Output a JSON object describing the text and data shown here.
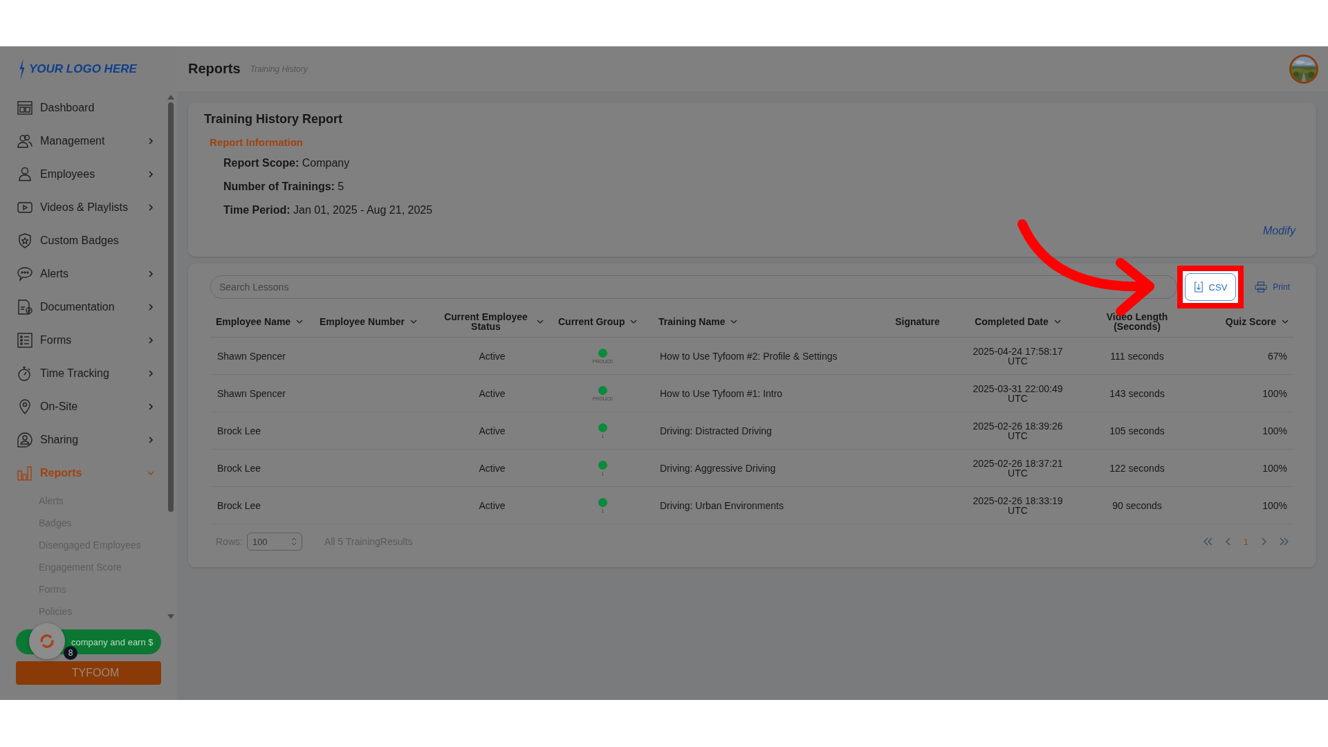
{
  "logo": {
    "text": "YOUR LOGO HERE"
  },
  "header": {
    "title": "Reports",
    "subtitle": "Training History"
  },
  "sidebar": {
    "items": [
      {
        "label": "Dashboard",
        "has_submenu": false,
        "selected": false
      },
      {
        "label": "Management",
        "has_submenu": true,
        "expanded": false,
        "selected": false
      },
      {
        "label": "Employees",
        "has_submenu": true,
        "expanded": false,
        "selected": false
      },
      {
        "label": "Videos & Playlists",
        "has_submenu": true,
        "expanded": false,
        "selected": false
      },
      {
        "label": "Custom Badges",
        "has_submenu": false,
        "selected": false
      },
      {
        "label": "Alerts",
        "has_submenu": true,
        "expanded": false,
        "selected": false
      },
      {
        "label": "Documentation",
        "has_submenu": true,
        "expanded": false,
        "selected": false
      },
      {
        "label": "Forms",
        "has_submenu": true,
        "expanded": false,
        "selected": false
      },
      {
        "label": "Time Tracking",
        "has_submenu": true,
        "expanded": false,
        "selected": false
      },
      {
        "label": "On-Site",
        "has_submenu": true,
        "expanded": false,
        "selected": false
      },
      {
        "label": "Sharing",
        "has_submenu": true,
        "expanded": false,
        "selected": false
      },
      {
        "label": "Reports",
        "has_submenu": true,
        "expanded": true,
        "selected": true,
        "children": [
          {
            "label": "Alerts"
          },
          {
            "label": "Badges"
          },
          {
            "label": "Disengaged Employees"
          },
          {
            "label": "Engagement Score"
          },
          {
            "label": "Forms"
          },
          {
            "label": "Policies"
          }
        ]
      }
    ],
    "refer_button": {
      "label": "company and earn $"
    },
    "brand_button": {
      "label": "TYFOOM"
    },
    "chat_widget": {
      "badge": "8"
    }
  },
  "report_card": {
    "title": "Training History Report",
    "section": "Report Information",
    "fields": [
      {
        "label": "Report Scope:",
        "value": "Company"
      },
      {
        "label": "Number of Trainings:",
        "value": "5"
      },
      {
        "label": "Time Period:",
        "value": "Jan 01, 2025 - Aug 21, 2025"
      }
    ],
    "modify_link": "Modify"
  },
  "toolbar": {
    "search": {
      "placeholder": "Search Lessons"
    },
    "csv_button": {
      "label": "CSV",
      "highlighted": true
    },
    "print_button": {
      "label": "Print"
    }
  },
  "table": {
    "columns": [
      {
        "label": "Employee Name",
        "sortable": true
      },
      {
        "label": "Employee Number",
        "sortable": true
      },
      {
        "label": "Current Employee Status",
        "sortable": true
      },
      {
        "label": "Current Group",
        "sortable": true
      },
      {
        "label": "Training Name",
        "sortable": true
      },
      {
        "label": "Signature",
        "sortable": false
      },
      {
        "label": "Completed Date",
        "sortable": true
      },
      {
        "label": "Video Length (Seconds)",
        "sortable": false
      },
      {
        "label": "Quiz Score",
        "sortable": true
      }
    ],
    "rows": [
      {
        "employee_name": "Shawn Spencer",
        "status": "Active",
        "group": {
          "color": "#0c8a3c",
          "label": "PROUCE"
        },
        "training_name": "How to Use Tyfoom #2: Profile & Settings",
        "completed_date": "2025-04-24 17:58:17 UTC",
        "video_length": "111 seconds",
        "quiz_score": "67%"
      },
      {
        "employee_name": "Shawn Spencer",
        "status": "Active",
        "group": {
          "color": "#0c8a3c",
          "label": "PROUCE"
        },
        "training_name": "How to Use Tyfoom #1: Intro",
        "completed_date": "2025-03-31 22:00:49 UTC",
        "video_length": "143 seconds",
        "quiz_score": "100%"
      },
      {
        "employee_name": "Brock Lee",
        "status": "Active",
        "group": {
          "color": "#0c8a3c",
          "label": "1"
        },
        "training_name": "Driving: Distracted Driving",
        "completed_date": "2025-02-26 18:39:26 UTC",
        "video_length": "105 seconds",
        "quiz_score": "100%"
      },
      {
        "employee_name": "Brock Lee",
        "status": "Active",
        "group": {
          "color": "#0c8a3c",
          "label": "1"
        },
        "training_name": "Driving: Aggressive Driving",
        "completed_date": "2025-02-26 18:37:21 UTC",
        "video_length": "122 seconds",
        "quiz_score": "100%"
      },
      {
        "employee_name": "Brock Lee",
        "status": "Active",
        "group": {
          "color": "#0c8a3c",
          "label": "1"
        },
        "training_name": "Driving: Urban Environments",
        "completed_date": "2025-02-26 18:33:19 UTC",
        "video_length": "90 seconds",
        "quiz_score": "100%"
      }
    ]
  },
  "footer": {
    "rows_label": "Rows:",
    "rows_value": "100",
    "summary": "All 5 TrainingResults",
    "page": "1"
  }
}
